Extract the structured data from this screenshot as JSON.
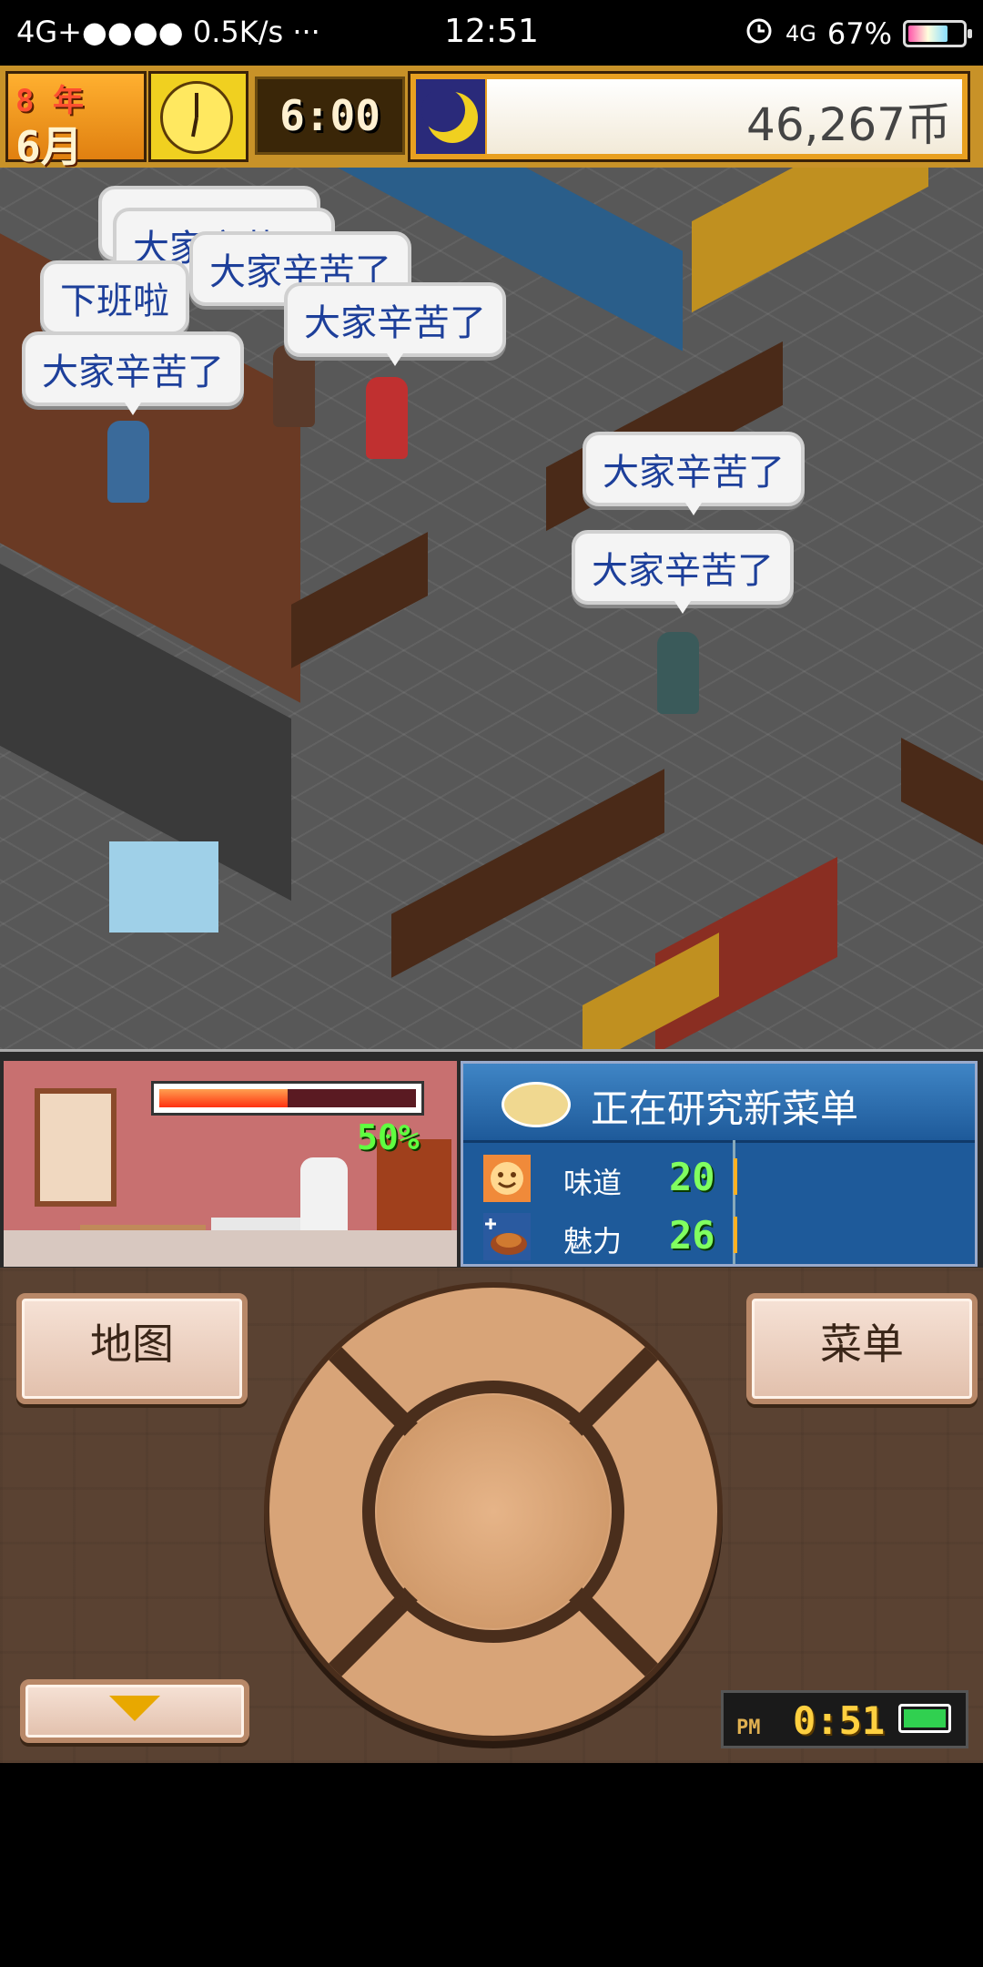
{
  "status_bar": {
    "network": "4G+",
    "signal_dots": "●●●●",
    "speed": "0.5K/s",
    "more": "···",
    "time": "12:51",
    "alarm_icon": "alarm-icon",
    "network2": "4G",
    "battery_percent": "67%",
    "battery_level": 0.67
  },
  "hud": {
    "year_value": "8",
    "year_label": "年",
    "month_value": "6",
    "month_label": "月",
    "clock_time": "6:00",
    "money": "46,267币",
    "period_icon": "moon-icon"
  },
  "bubbles": [
    {
      "text": "大家辛苦了"
    },
    {
      "text": "大家辛苦了"
    },
    {
      "text": "大家辛苦了"
    },
    {
      "text": "下班啦"
    },
    {
      "text": "大家辛苦了"
    },
    {
      "text": "大家辛苦了"
    },
    {
      "text": "大家辛苦了"
    },
    {
      "text": "大家辛苦了"
    }
  ],
  "research": {
    "progress_percent": "50%",
    "progress": 0.5,
    "title": "正在研究新菜单",
    "stats": [
      {
        "label": "味道",
        "value": "20",
        "icon": "taste-icon"
      },
      {
        "label": "魅力",
        "value": "26",
        "icon": "charm-icon"
      }
    ]
  },
  "controls": {
    "map_label": "地图",
    "menu_label": "菜单",
    "ampm": "PM",
    "game_time": "0:51"
  },
  "colors": {
    "bubble_text": "#1d3f9a",
    "research_bg": "#1e5a9a",
    "control_bg": "#5a4232",
    "button_face": "#f6e2d6"
  }
}
